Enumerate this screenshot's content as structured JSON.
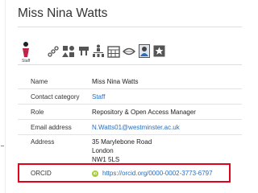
{
  "header": {
    "title": "Miss Nina Watts"
  },
  "icons": {
    "selected_label": "Staff",
    "items": [
      "staff-icon",
      "relationship-icon",
      "shapes-icon",
      "org-chart-icon",
      "hierarchy-icon",
      "calendar-icon",
      "lips-icon",
      "photo-icon",
      "star-icon"
    ]
  },
  "details": {
    "rows": [
      {
        "label": "Name",
        "value": "Miss Nina Watts"
      },
      {
        "label": "Contact category",
        "value": "Staff"
      },
      {
        "label": "Role",
        "value": "Repository & Open Access Manager"
      },
      {
        "label": "Email address",
        "value": "N.Watts01@westminster.ac.uk"
      },
      {
        "label": "Address",
        "value_lines": [
          "35 Marylebone Road",
          "London",
          "NW1 5LS"
        ]
      }
    ],
    "orcid": {
      "label": "ORCID",
      "badge": "iD",
      "value": "https://orcid.org/0000-0002-3773-6797"
    }
  },
  "colors": {
    "link": "#2a6ebb",
    "highlight": "#e2001a",
    "orcid_green": "#a6ce39"
  }
}
